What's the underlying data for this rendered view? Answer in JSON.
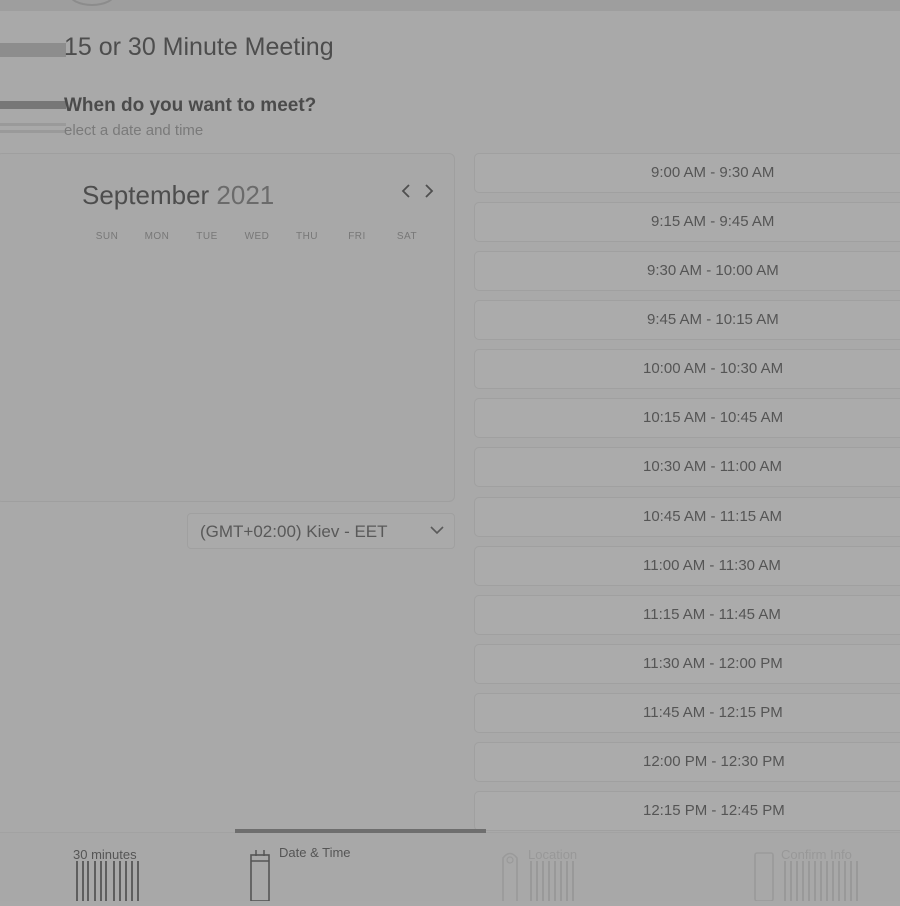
{
  "meeting": {
    "title": "15 or 30 Minute Meeting"
  },
  "scheduler": {
    "question": "When do you want to meet?",
    "instruction": "elect a date and time"
  },
  "calendar": {
    "month": "September",
    "year": "2021",
    "prev_icon": "chevron-left-icon",
    "next_icon": "chevron-right-icon",
    "weekdays": [
      "SUN",
      "MON",
      "TUE",
      "WED",
      "THU",
      "FRI",
      "SAT"
    ]
  },
  "timezone": {
    "selected": "(GMT+02:00) Kiev - EET",
    "icon": "chevron-down-icon"
  },
  "time_slots": [
    "9:00 AM - 9:30 AM",
    "9:15 AM - 9:45 AM",
    "9:30 AM - 10:00 AM",
    "9:45 AM - 10:15 AM",
    "10:00 AM - 10:30 AM",
    "10:15 AM - 10:45 AM",
    "10:30 AM - 11:00 AM",
    "10:45 AM - 11:15 AM",
    "11:00 AM - 11:30 AM",
    "11:15 AM - 11:45 AM",
    "11:30 AM - 12:00 PM",
    "11:45 AM - 12:15 PM",
    "12:00 PM - 12:30 PM",
    "12:15 PM - 12:45 PM"
  ],
  "steps": {
    "duration": "30 minutes",
    "date_time": "Date & Time",
    "location": "Location",
    "confirm": "Confirm Info",
    "active_step": "Date & Time"
  },
  "colors": {
    "background": "#a9a9a9",
    "text": "#4a4a4a",
    "progress": "#6e6e6e"
  }
}
